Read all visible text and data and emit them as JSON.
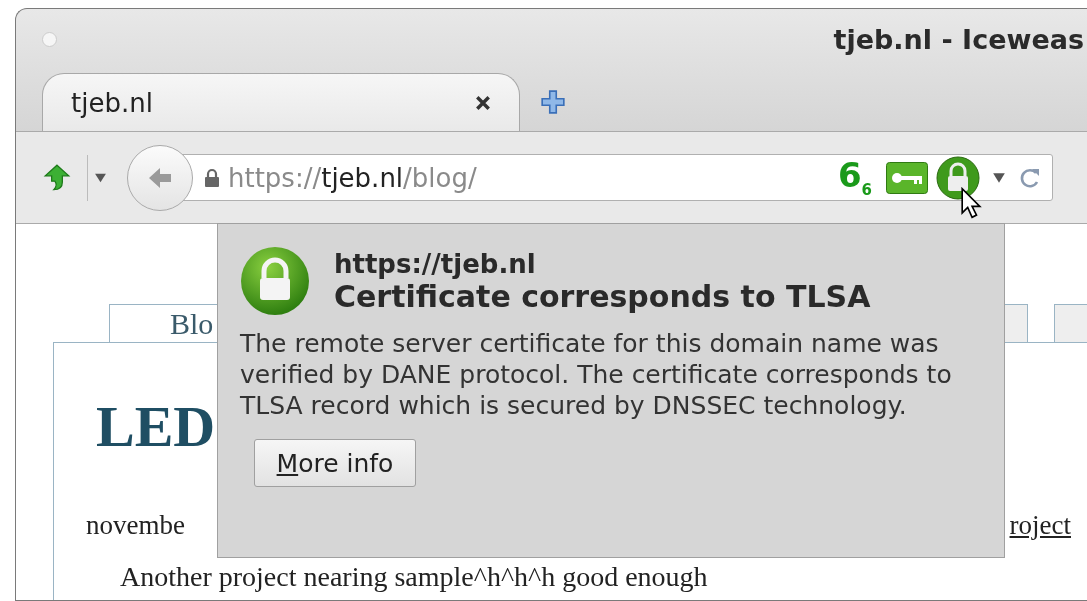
{
  "window": {
    "title": "tjeb.nl - Iceweas"
  },
  "tabs": [
    {
      "label": "tjeb.nl",
      "selected": true
    }
  ],
  "nav_bar": {
    "url": {
      "scheme": "https://",
      "host": "tjeb.nl",
      "path": "/blog/"
    },
    "badge": "6$_{6}$"
  },
  "page": {
    "nav_tabs": [
      {
        "label": "Blo",
        "selected": true
      },
      {
        "selected": false
      },
      {
        "selected": false
      }
    ],
    "heading": "LED",
    "date": "novembe",
    "link": "roject",
    "paragraph": "Another project nearing sample^h^h^h good enough"
  },
  "popup": {
    "site": "https://tjeb.nl",
    "title": "Certificate corresponds to TLSA",
    "body": "The remote server certificate for this domain name was verified by DANE protocol. The certificate corresponds to TLSA record which is secured by DNSSEC technology.",
    "button": "More info"
  }
}
